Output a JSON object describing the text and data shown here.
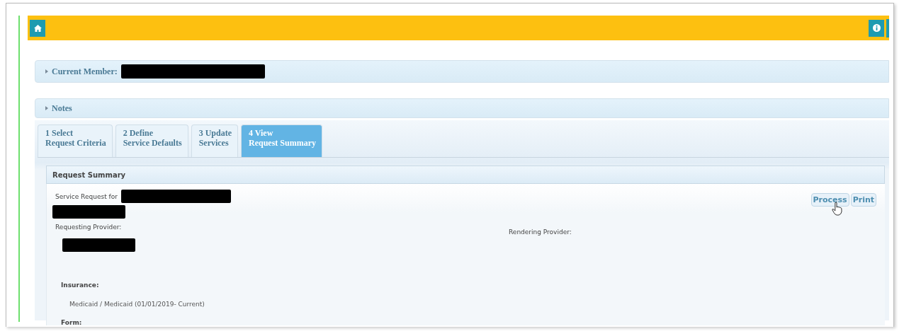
{
  "panels": [
    {
      "label": "Current Member:",
      "redacted": true
    },
    {
      "label": "Notes",
      "redacted": false
    }
  ],
  "tabs": [
    {
      "lines": [
        "1 Select",
        "Request Criteria"
      ],
      "selected": false
    },
    {
      "lines": [
        "2 Define",
        "Service Defaults"
      ],
      "selected": false
    },
    {
      "lines": [
        "3 Update",
        "Services"
      ],
      "selected": false
    },
    {
      "lines": [
        "4 View",
        "Request Summary"
      ],
      "selected": true
    }
  ],
  "summary": {
    "title": "Request Summary",
    "service_request_label": "Service Request for",
    "buttons": [
      "Process",
      "Print"
    ],
    "requesting_provider_label": "Requesting Provider:",
    "rendering_provider_label": "Rendering Provider:",
    "insurance_label": "Insurance:",
    "insurance_value": "Medicaid / Medicaid (01/01/2019- Current)",
    "form_label": "Form:"
  }
}
